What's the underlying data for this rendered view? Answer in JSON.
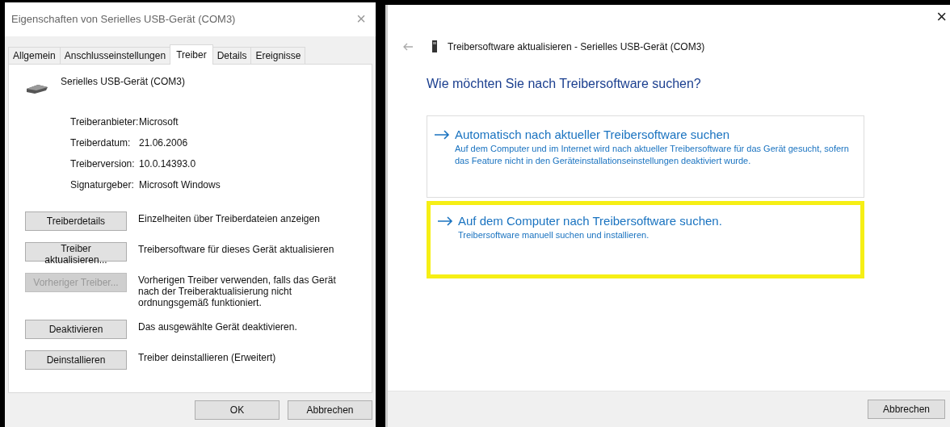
{
  "properties_dialog": {
    "title": "Eigenschaften von Serielles USB-Gerät (COM3)",
    "close": "×",
    "tabs": [
      {
        "label": "Allgemein",
        "selected": false
      },
      {
        "label": "Anschlusseinstellungen",
        "selected": false
      },
      {
        "label": "Treiber",
        "selected": true
      },
      {
        "label": "Details",
        "selected": false
      },
      {
        "label": "Ereignisse",
        "selected": false
      }
    ],
    "device_name": "Serielles USB-Gerät (COM3)",
    "info": [
      {
        "label": "Treiberanbieter:",
        "value": "Microsoft"
      },
      {
        "label": "Treiberdatum:",
        "value": "21.06.2006"
      },
      {
        "label": "Treiberversion:",
        "value": "10.0.14393.0"
      },
      {
        "label": "Signaturgeber:",
        "value": "Microsoft Windows"
      }
    ],
    "actions": [
      {
        "button": "Treiberdetails",
        "disabled": false,
        "description": "Einzelheiten über Treiberdateien anzeigen"
      },
      {
        "button": "Treiber aktualisieren...",
        "disabled": false,
        "description": "Treibersoftware für dieses Gerät aktualisieren"
      },
      {
        "button": "Vorheriger Treiber...",
        "disabled": true,
        "description": "Vorherigen Treiber verwenden, falls das Gerät nach der Treiberaktualisierung nicht ordnungsgemäß funktioniert."
      },
      {
        "button": "Deaktivieren",
        "disabled": false,
        "description": "Das ausgewählte Gerät deaktivieren."
      },
      {
        "button": "Deinstallieren",
        "disabled": false,
        "description": "Treiber deinstallieren (Erweitert)"
      }
    ],
    "buttons": [
      "OK",
      "Abbrechen"
    ]
  },
  "update_wizard": {
    "close": "×",
    "title": "Treibersoftware aktualisieren - Serielles USB-Gerät (COM3)",
    "heading": "Wie möchten Sie nach Treibersoftware suchen?",
    "options": [
      {
        "title": "Automatisch nach aktueller Treibersoftware suchen",
        "description": "Auf dem Computer und im Internet wird nach aktueller Treibersoftware für das Gerät gesucht, sofern das Feature nicht in den Geräteinstallationseinstellungen deaktiviert wurde.",
        "highlighted": false
      },
      {
        "title": "Auf dem Computer nach Treibersoftware suchen.",
        "description": "Treibersoftware manuell suchen und installieren.",
        "highlighted": true
      }
    ],
    "buttons": [
      "Abbrechen"
    ]
  }
}
